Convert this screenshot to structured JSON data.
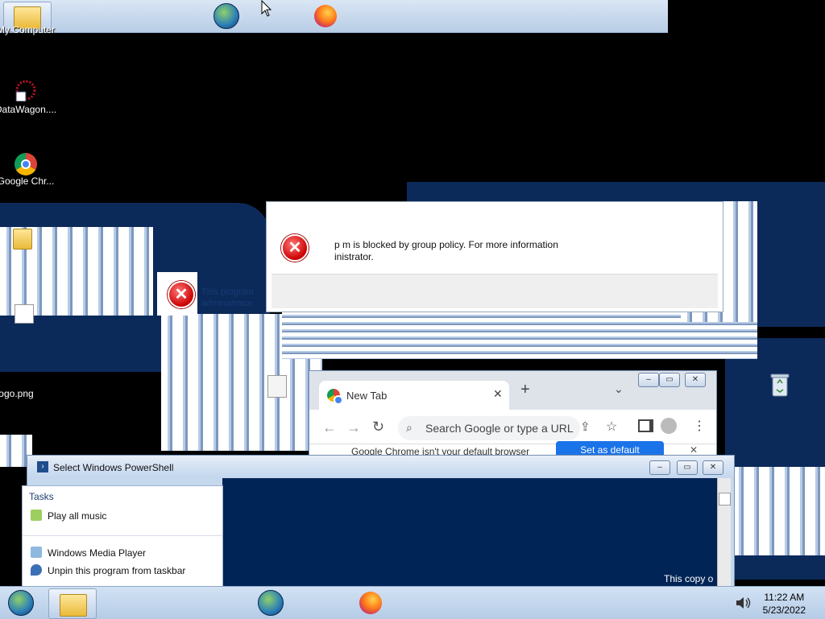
{
  "desktop": {
    "icons": [
      {
        "label": "My Computer"
      },
      {
        "label": "DataWagon...."
      },
      {
        "label": "Google Chr..."
      },
      {
        "label": "ogo.png"
      }
    ],
    "watermark": "This copy o"
  },
  "error_dialog": {
    "message_line1": "p        m is blocked by group policy. For more information",
    "message_line2": "inistrator.",
    "ghost_line1": "This program",
    "ghost_line2": "administrator"
  },
  "chrome": {
    "tab_title": "New Tab",
    "omnibox_placeholder": "Search Google or type a URL",
    "infobar_text": "Google Chrome isn't your default browser",
    "infobar_button": "Set as default"
  },
  "powershell": {
    "title": "Select Windows PowerShell"
  },
  "jumplist": {
    "header": "Tasks",
    "items": [
      {
        "label": "Play all music"
      },
      {
        "label": "Windows Media Player"
      },
      {
        "label": "Unpin this program from taskbar"
      }
    ]
  },
  "taskbar": {
    "time": "11:22 AM",
    "date": "5/23/2022"
  },
  "colors": {
    "desktop_navy": "#0b2a5a",
    "powershell_bg": "#012456",
    "chrome_blue": "#1a73e8",
    "error_red": "#cc0000"
  }
}
